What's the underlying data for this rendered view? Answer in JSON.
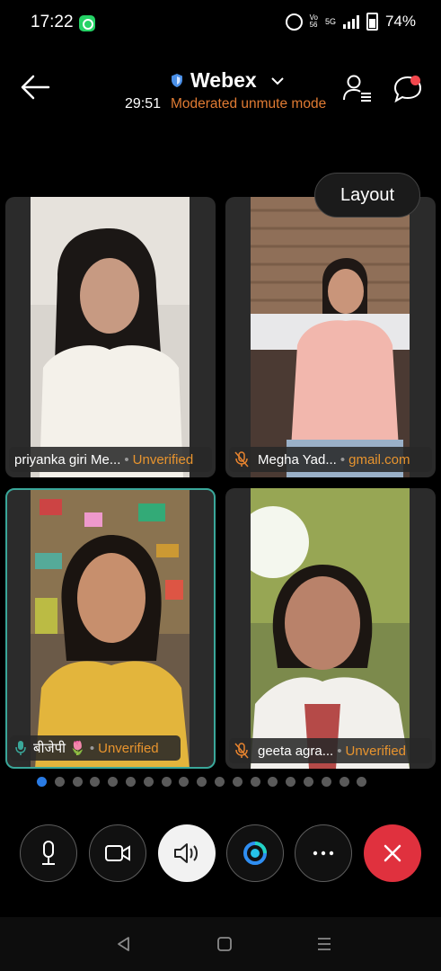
{
  "status_bar": {
    "time": "17:22",
    "net_top": "Vo",
    "net_bottom": "56",
    "net_type": "5G",
    "battery": "74%"
  },
  "header": {
    "app_title": "Webex",
    "timer": "29:51",
    "mode": "Moderated unmute mode"
  },
  "layout_button": "Layout",
  "participants": [
    {
      "name": "priyanka giri Me...",
      "status": "Unverified",
      "muted": false,
      "show_mic": false,
      "active": false
    },
    {
      "name": "Megha Yad...",
      "status": "gmail.com",
      "muted": true,
      "show_mic": true,
      "active": false
    },
    {
      "name": "बीजेपी 🌷",
      "status": "Unverified",
      "muted": false,
      "show_mic": true,
      "active": true
    },
    {
      "name": "geeta agra...",
      "status": "Unverified",
      "muted": true,
      "show_mic": true,
      "active": false
    }
  ],
  "pager": {
    "total": 19,
    "current": 1
  },
  "controls": [
    "mic-icon",
    "video-camera-icon",
    "speaker-icon",
    "webex-assistant-icon",
    "more-icon",
    "end-call-icon"
  ],
  "colors": {
    "accent_orange": "#e07b33",
    "active_border": "#3aa79a",
    "end_call": "#e0313e",
    "pager_active": "#2a7be4",
    "chat_badge": "#f2474d"
  }
}
